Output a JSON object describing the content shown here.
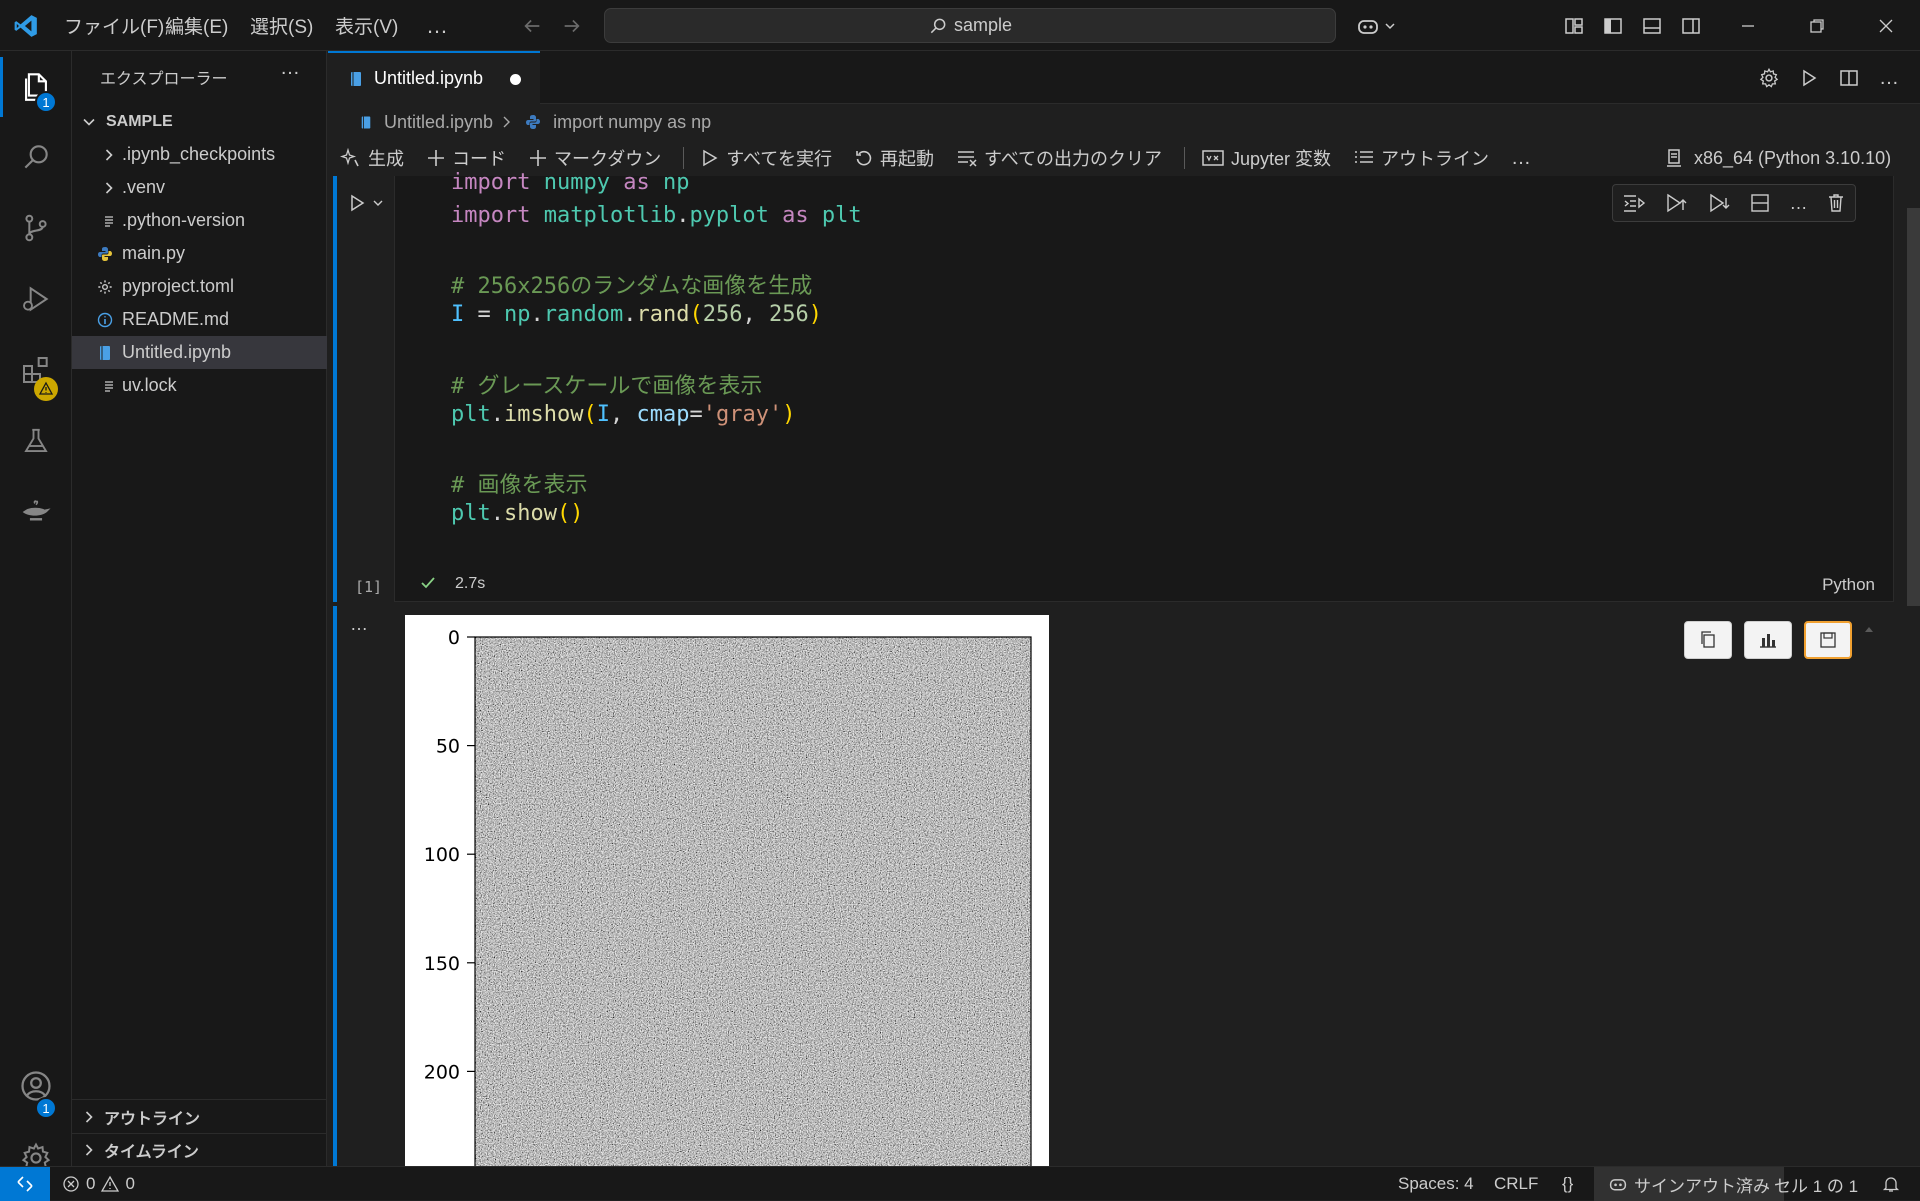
{
  "titlebar": {
    "menus": [
      "ファイル(F)",
      "編集(E)",
      "選択(S)",
      "表示(V)",
      "…"
    ],
    "search": "sample"
  },
  "activity": {
    "explorer_badge": "1",
    "accounts_badge": "1"
  },
  "sidebar": {
    "title": "エクスプローラー",
    "more": "…",
    "folder": "SAMPLE",
    "items": [
      {
        "label": ".ipynb_checkpoints",
        "icon": "chevron-right-icon"
      },
      {
        "label": ".venv",
        "icon": "chevron-right-icon"
      },
      {
        "label": ".python-version",
        "icon": "lines-icon"
      },
      {
        "label": "main.py",
        "icon": "python-icon"
      },
      {
        "label": "pyproject.toml",
        "icon": "gear-icon"
      },
      {
        "label": "README.md",
        "icon": "info-icon"
      },
      {
        "label": "Untitled.ipynb",
        "icon": "notebook-icon"
      },
      {
        "label": "uv.lock",
        "icon": "lines-icon"
      }
    ],
    "outline": "アウトライン",
    "timeline": "タイムライン"
  },
  "tab": {
    "label": "Untitled.ipynb"
  },
  "breadcrumb": {
    "file": "Untitled.ipynb",
    "cell": "import numpy as np"
  },
  "notebook_toolbar": {
    "generate": "生成",
    "code": "コード",
    "markdown": "マークダウン",
    "run_all": "すべてを実行",
    "restart": "再起動",
    "clear_outputs": "すべての出力のクリア",
    "variables": "Jupyter 変数",
    "outline": "アウトライン",
    "more": "…",
    "kernel": "x86_64 (Python 3.10.10)"
  },
  "cell": {
    "exec_count": "[1]",
    "duration": "2.7s",
    "language": "Python",
    "comments": [
      "# 256x256のランダムな画像を生成",
      "# グレースケールで画像を表示",
      "# 画像を表示"
    ],
    "output_more": "…"
  },
  "plot": {
    "y_ticks": [
      "0",
      "50",
      "100",
      "150",
      "200"
    ]
  },
  "statusbar": {
    "errors": "0",
    "warnings": "0",
    "spaces": "Spaces: 4",
    "eol": "CRLF",
    "braces": "{}",
    "account": "サインアウト済み",
    "cell_pos": "セル 1 の 1"
  },
  "colors": {
    "accent": "#0078d4",
    "background": "#1f1f1f",
    "sidebar": "#181818",
    "check": "#89d185",
    "selected_output_button": "#f0a030"
  }
}
